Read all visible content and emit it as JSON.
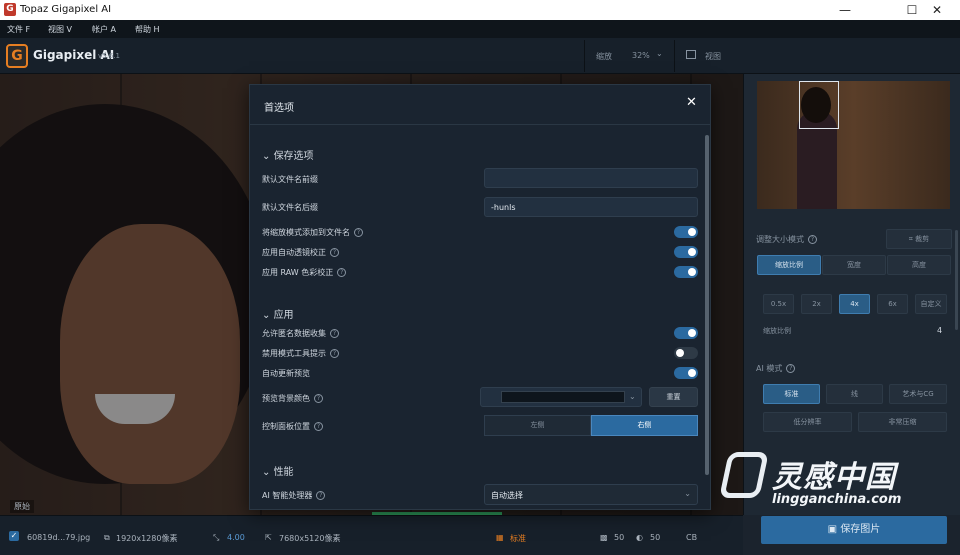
{
  "titlebar": {
    "title": "Topaz Gigapixel AI",
    "logo_letter": "G",
    "minimize": "—",
    "maximize": "☐",
    "close": "✕"
  },
  "menubar": {
    "items": [
      "文件 F",
      "视图 V",
      "帐户 A",
      "帮助 H"
    ]
  },
  "appbar": {
    "logo_letter": "G",
    "app_name": "Gigapixel AI",
    "version": "v5.6.1",
    "zoom_label": "缩放",
    "zoom_value": "32%",
    "view_label": "视图"
  },
  "preview": {
    "original_tag": "原始"
  },
  "bottombar": {
    "filename": "60819d...79.jpg",
    "original_size": "1920x1280像素",
    "scale": "4.00",
    "output_size": "7680x5120像素",
    "mode": "标准",
    "noise": "50",
    "blur": "50",
    "cb": "CB"
  },
  "rightpanel": {
    "resize_mode_label": "调整大小模式",
    "crop_label": "裁剪",
    "resize_tabs": [
      "缩放比例",
      "宽度",
      "高度"
    ],
    "scale_buttons": [
      "0.5x",
      "2x",
      "4x",
      "6x",
      "自定义"
    ],
    "scale_ratio_label": "缩放比例",
    "scale_ratio_value": "4",
    "ai_mode_label": "AI 模式",
    "ai_modes": [
      "标准",
      "线",
      "艺术与CG",
      "低分辨率",
      "非常压缩"
    ],
    "save_label": "保存图片"
  },
  "modal": {
    "title": "首选项",
    "close": "✕",
    "sections": {
      "save": "保存选项",
      "app": "应用",
      "perf": "性能"
    },
    "save_options": {
      "prefix_label": "默认文件名前缀",
      "prefix_value": "",
      "suffix_label": "默认文件名后缀",
      "suffix_value": "-hunls",
      "add_scale_label": "将缩放模式添加到文件名",
      "auto_lens_label": "应用自动透镜校正",
      "raw_color_label": "应用 RAW 色彩校正"
    },
    "app_options": {
      "anon_data_label": "允许匿名数据收集",
      "disable_tips_label": "禁用模式工具提示",
      "auto_preview_label": "自动更新预览",
      "bg_color_label": "预览背景颜色",
      "reset_label": "重置",
      "panel_pos_label": "控制面板位置",
      "panel_left": "左侧",
      "panel_right": "右侧"
    },
    "perf_options": {
      "processor_label": "AI 智能处理器",
      "processor_value": "自动选择"
    }
  },
  "watermark": {
    "text": "灵感中国",
    "url": "lingganchina.com"
  },
  "colors": {
    "accent": "#2b6aa0",
    "bg": "#1b232d",
    "modal_bg": "#1a2430"
  }
}
